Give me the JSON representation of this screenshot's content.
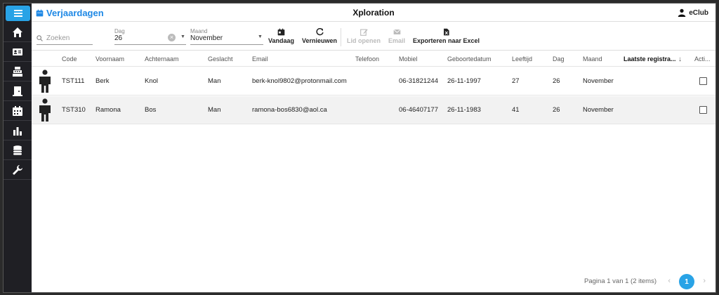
{
  "header": {
    "page_title": "Verjaardagen",
    "app_title": "Xploration",
    "user_name": "eClub"
  },
  "sidebar": {
    "items": [
      {
        "icon": "home-icon"
      },
      {
        "icon": "id-card-icon"
      },
      {
        "icon": "cash-register-icon"
      },
      {
        "icon": "door-icon"
      },
      {
        "icon": "calendar-icon"
      },
      {
        "icon": "bar-chart-icon"
      },
      {
        "icon": "coins-icon"
      },
      {
        "icon": "wrench-icon"
      }
    ]
  },
  "filters": {
    "search_placeholder": "Zoeken",
    "day_label": "Dag",
    "day_value": "26",
    "month_label": "Maand",
    "month_value": "November"
  },
  "toolbar": {
    "today": "Vandaag",
    "refresh": "Vernieuwen",
    "open_member": "Lid openen",
    "email": "Email",
    "export_excel": "Exporteren naar Excel"
  },
  "table": {
    "columns": [
      "Code",
      "Voornaam",
      "Achternaam",
      "Geslacht",
      "Email",
      "Telefoon",
      "Mobiel",
      "Geboortedatum",
      "Leeftijd",
      "Dag",
      "Maand",
      "Laatste registra...",
      "Acti..."
    ],
    "rows": [
      {
        "code": "TST111",
        "voornaam": "Berk",
        "achternaam": "Knol",
        "geslacht": "Man",
        "email": "berk-knol9802@protonmail.com",
        "telefoon": "",
        "mobiel": "06-31821244",
        "geboortedatum": "26-11-1997",
        "leeftijd": "27",
        "dag": "26",
        "maand": "November"
      },
      {
        "code": "TST310",
        "voornaam": "Ramona",
        "achternaam": "Bos",
        "geslacht": "Man",
        "email": "ramona-bos6830@aol.ca",
        "telefoon": "",
        "mobiel": "06-46407177",
        "geboortedatum": "26-11-1983",
        "leeftijd": "41",
        "dag": "26",
        "maand": "November"
      }
    ]
  },
  "pagination": {
    "text": "Pagina 1 van 1 (2 items)",
    "current": "1",
    "prev": "‹",
    "next": "›"
  },
  "colors": {
    "accent": "#29a3e6",
    "title_blue": "#1e88e5",
    "sidebar_bg": "#1f1f24"
  }
}
